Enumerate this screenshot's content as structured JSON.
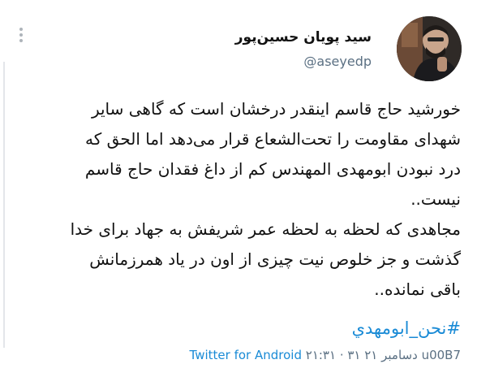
{
  "author": {
    "display_name": "سید پویان حسین‌پور",
    "handle": "@aseyedp"
  },
  "tweet": {
    "lines": [
      "خورشید حاج قاسم اینقدر درخشان است که گاهی سایر",
      "شهدای مقاومت را تحت‌الشعاع قرار می‌دهد اما الحق که",
      "درد نبودن ابومهدی المهندس کم از داغ فقدان حاج قاسم",
      "نیست..",
      "مجاهدی که لحظه به لحظه عمر شریفش به جهاد برای خدا",
      "گذشت و جز خلوص نیت چیزی از اون در یاد همرزمانش",
      "باقی نمانده.."
    ],
    "hashtag": "#نحن_ابومهدي"
  },
  "meta": {
    "time": "۲۱:۳۱ · ۳۱ دسامبر ۲۱ u00B7",
    "client": "Twitter for Android"
  },
  "icons": {
    "more": "more-vertical-icon"
  },
  "colors": {
    "link": "#1a8bd6",
    "muted": "#5b7083",
    "text": "#111111"
  }
}
